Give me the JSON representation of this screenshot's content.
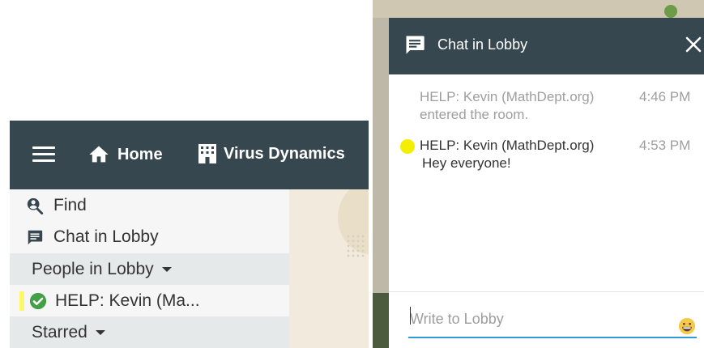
{
  "topbar": {
    "home_label": "Home",
    "room_label": "Virus Dynamics"
  },
  "sidebar": {
    "find_label": "Find",
    "chat_label": "Chat in Lobby",
    "people_label": "People in Lobby",
    "kevin_label": "HELP: Kevin (Ma...",
    "starred_label": "Starred"
  },
  "chat": {
    "title": "Chat in Lobby",
    "messages": [
      {
        "author": "HELP: Kevin (MathDept.org)",
        "time": "4:46 PM",
        "text": "entered the room."
      },
      {
        "author": "HELP: Kevin (MathDept.org)",
        "time": "4:53 PM",
        "text": "Hey everyone!"
      }
    ],
    "input_placeholder": "Write to Lobby"
  },
  "colors": {
    "topbar_bg": "#37474f",
    "presence_yellow": "#f4ef00",
    "online_green": "#43a047",
    "input_accent": "#2f9ad8"
  },
  "icons": {
    "menu": "hamburger-icon",
    "home": "home-icon",
    "room": "building-icon",
    "find": "person-search-icon",
    "chat": "chat-bubble-icon",
    "online": "check-circle-icon",
    "close": "close-icon",
    "emoji": "grinning-face-icon"
  }
}
